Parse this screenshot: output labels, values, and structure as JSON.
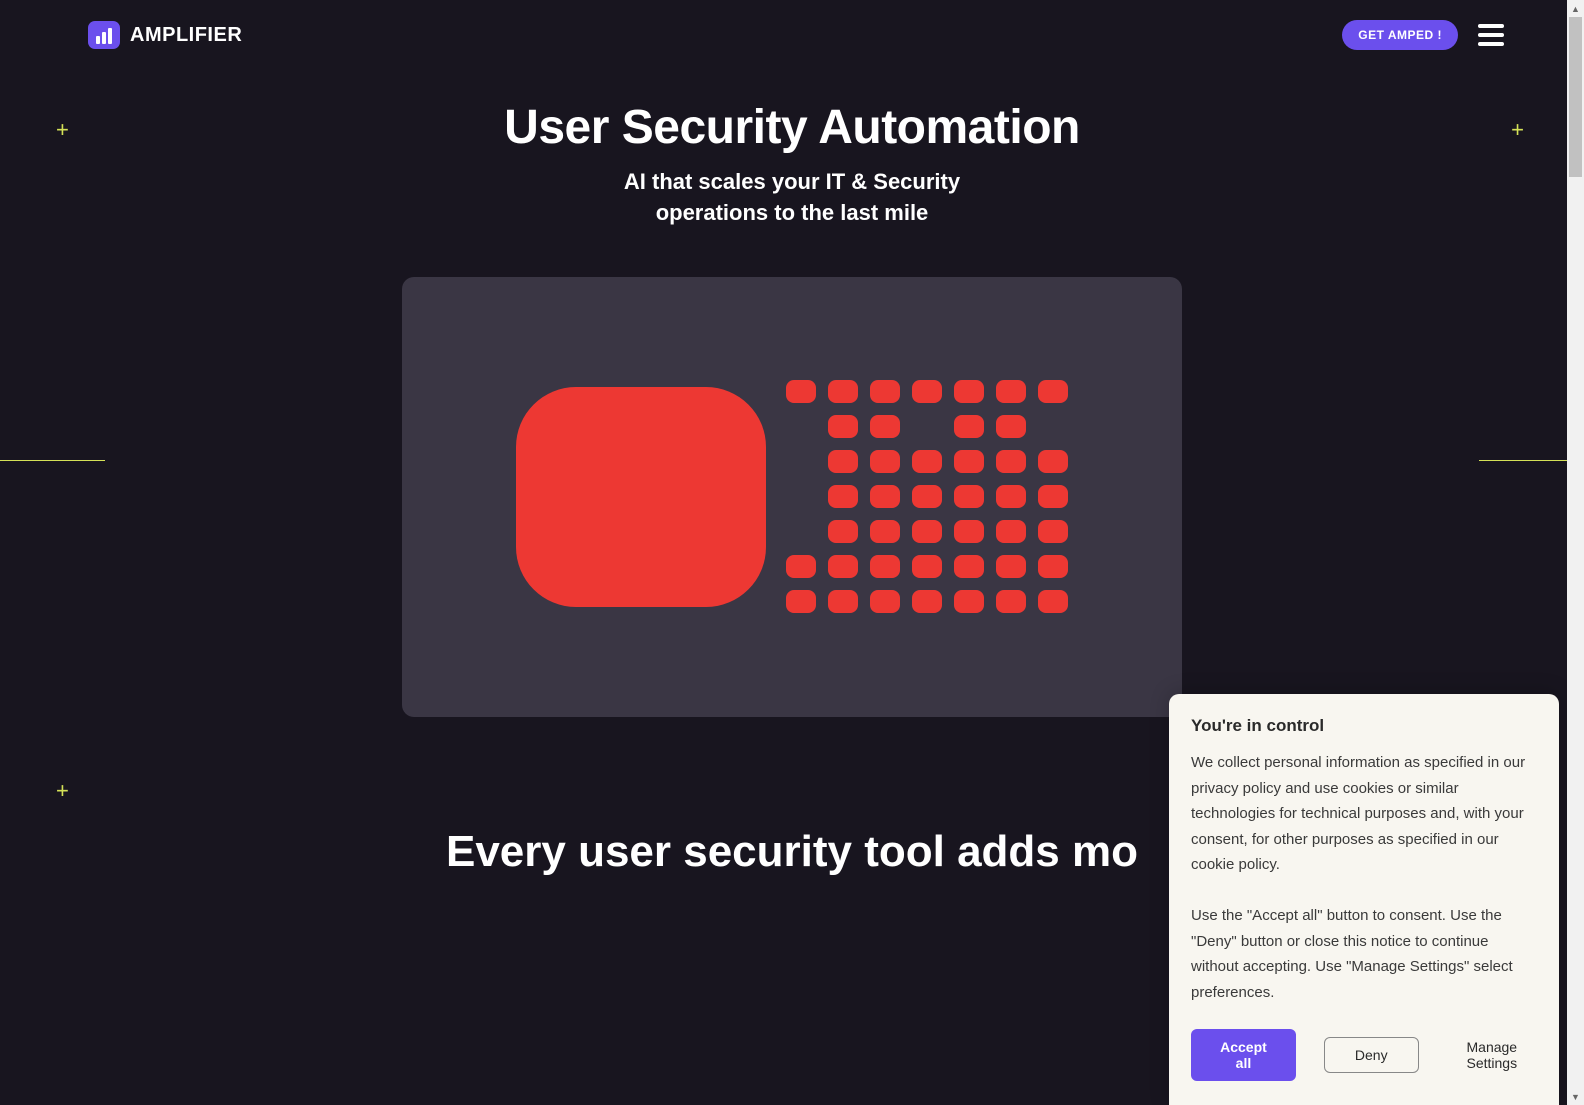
{
  "header": {
    "logo_text": "AMPLIFIER",
    "cta_label": "GET AMPED !"
  },
  "hero": {
    "title": "User Security Automation",
    "subtitle_line1": "AI that scales your IT & Security",
    "subtitle_line2": "operations to the last mile"
  },
  "section": {
    "title": "Every user security tool adds mo"
  },
  "cookie": {
    "title": "You're in control",
    "paragraph1": "We collect personal information as specified in our privacy policy and use cookies or similar technologies for technical purposes and, with your consent, for other purposes as specified in our cookie policy.",
    "paragraph2": "Use the \"Accept all\" button to consent. Use the \"Deny\" button or close this notice to continue without accepting. Use \"Manage Settings\" select preferences.",
    "accept_label": "Accept all",
    "deny_label": "Deny",
    "manage_label": "Manage Settings"
  },
  "colors": {
    "background": "#18151f",
    "accent": "#6B4FED",
    "red": "#ED3833",
    "yellow": "#d4e157"
  }
}
